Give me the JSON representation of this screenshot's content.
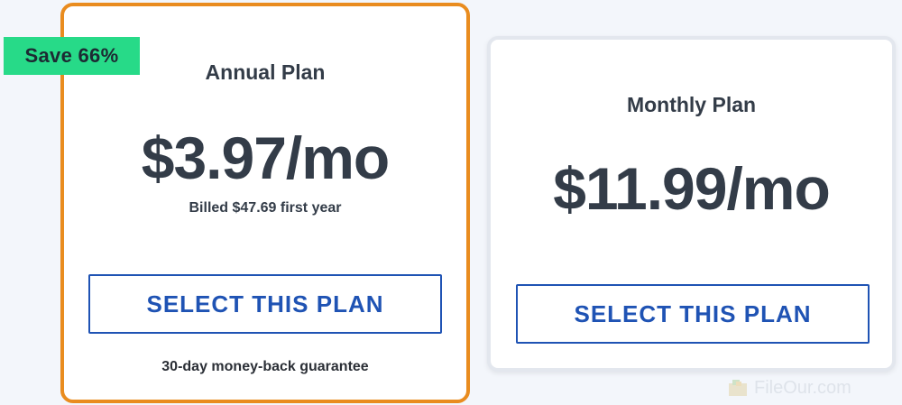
{
  "badge": {
    "label": "Save 66%"
  },
  "annual": {
    "title": "Annual Plan",
    "price": "$3.97/mo",
    "billed": "Billed $47.69 first year",
    "button_label": "SELECT THIS PLAN",
    "guarantee": "30-day money-back guarantee"
  },
  "monthly": {
    "title": "Monthly Plan",
    "price": "$11.99/mo",
    "button_label": "SELECT THIS PLAN"
  },
  "watermark": {
    "text": "FileOur.com",
    "icon": "fileour-logo-icon"
  },
  "colors": {
    "accent_orange": "#e98c1f",
    "badge_green": "#27da88",
    "button_blue": "#1f53b4",
    "text_dark": "#333c48",
    "background": "#f3f6fb"
  }
}
